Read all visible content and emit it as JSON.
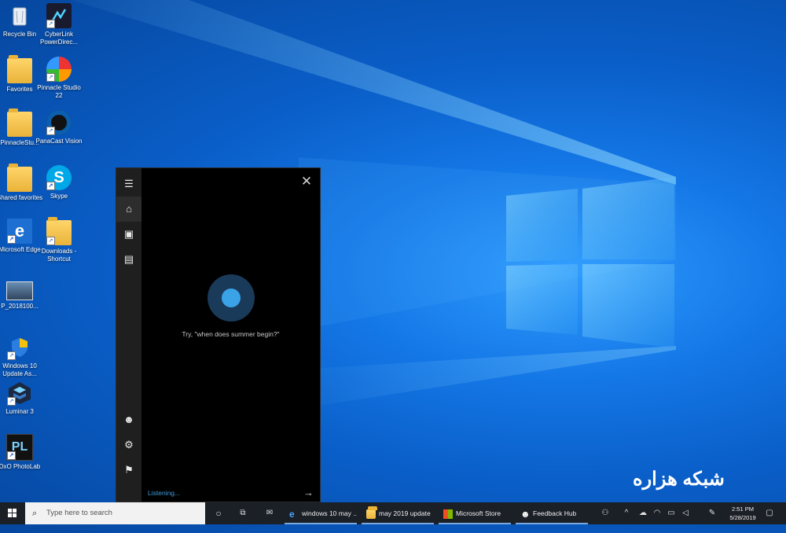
{
  "desktop_icons": [
    {
      "label": "Recycle Bin",
      "icon": "recycle-bin-icon"
    },
    {
      "label": "CyberLink PowerDirec...",
      "icon": "cyberlink-icon"
    },
    {
      "label": "Favorites",
      "icon": "folder-icon"
    },
    {
      "label": "Pinnacle Studio 22",
      "icon": "pinnacle-icon"
    },
    {
      "label": "PinnacleStu...",
      "icon": "folder-icon"
    },
    {
      "label": "PanaCast Vision",
      "icon": "panacast-icon"
    },
    {
      "label": "Shared favorites",
      "icon": "folder-icon"
    },
    {
      "label": "Skype",
      "icon": "skype-icon"
    },
    {
      "label": "Microsoft Edge",
      "icon": "edge-icon"
    },
    {
      "label": "Downloads - Shortcut",
      "icon": "folder-icon"
    },
    {
      "label": "P_2018100...",
      "icon": "image-icon"
    },
    {
      "label": "Windows 10 Update As...",
      "icon": "windows-update-icon"
    },
    {
      "label": "Luminar 3",
      "icon": "luminar-icon"
    },
    {
      "label": "DxO PhotoLab",
      "icon": "dxo-icon"
    }
  ],
  "cortana": {
    "prompt": "Try, \"when does summer begin?\"",
    "status": "Listening...",
    "rail": [
      "hamburger-icon",
      "home-icon",
      "notebook-icon",
      "collections-icon"
    ],
    "rail_bottom": [
      "avatar-icon",
      "settings-icon",
      "feedback-icon"
    ]
  },
  "taskbar": {
    "search_placeholder": "Type here to search",
    "apps": [
      {
        "label": "windows 10 may ...",
        "icon": "edge-icon"
      },
      {
        "label": "may 2019 update",
        "icon": "folder-icon"
      },
      {
        "label": "Microsoft Store",
        "icon": "store-icon"
      },
      {
        "label": "Feedback Hub",
        "icon": "feedback-hub-icon"
      }
    ],
    "time": "2:51 PM",
    "date": "5/28/2019"
  },
  "watermark": "شبکه هزاره",
  "colors": {
    "accent": "#0078d7",
    "taskbar": "#1b1f26",
    "cortana_bg": "#000000"
  }
}
